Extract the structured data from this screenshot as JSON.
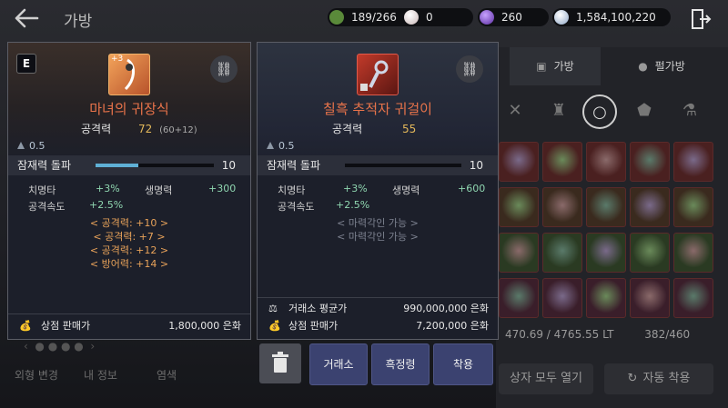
{
  "header": {
    "title": "가방",
    "currencies": [
      {
        "icon": "green-gem-icon",
        "value": "189/266"
      },
      {
        "icon": "pearl-icon",
        "value": "0"
      },
      {
        "icon": "purple-crystal-icon",
        "value": "260"
      },
      {
        "icon": "silver-coin-icon",
        "value": "1,584,100,220"
      }
    ]
  },
  "right_panel": {
    "tabs": [
      "가방",
      "펄가방"
    ],
    "weight": "470.69 / 4765.55 LT",
    "slots": "382/460",
    "buttons": {
      "open_all": "상자 모두 열기",
      "auto_equip": "자동 착용"
    }
  },
  "left_bottom": {
    "tabs": [
      "외형 변경",
      "내 정보",
      "염색"
    ]
  },
  "card_equipped": {
    "badge": "E",
    "name": "마녀의 귀장식",
    "enhance": "+3",
    "stat_label": "공격력",
    "stat_value": "72",
    "stat_extra": "(60+12)",
    "weight": "0.5",
    "potential_label": "잠재력 돌파",
    "potential_value": "10",
    "potential_fill": 0.36,
    "stats": [
      {
        "label": "치명타",
        "value": "+3%",
        "label2": "생명력",
        "value2": "+300"
      },
      {
        "label": "공격속도",
        "value": "+2.5%"
      }
    ],
    "engraves": [
      "< 공격력: +10 >",
      "< 공격력: +7 >",
      "< 공격력: +12 >",
      "< 방어력: +14 >"
    ],
    "shop_price_label": "상점 판매가",
    "shop_price": "1,800,000 은화"
  },
  "card_compare": {
    "name": "칠흑 추적자 귀걸이",
    "stat_label": "공격력",
    "stat_value": "55",
    "weight": "0.5",
    "potential_label": "잠재력 돌파",
    "potential_value": "10",
    "potential_fill": 0.0,
    "stats": [
      {
        "label": "치명타",
        "value": "+3%",
        "label2": "생명력",
        "value2": "+600"
      },
      {
        "label": "공격속도",
        "value": "+2.5%"
      }
    ],
    "engraves": [
      "< 마력각인 가능 >",
      "< 마력각인 가능 >"
    ],
    "market_price_label": "거래소 평균가",
    "market_price": "990,000,000 은화",
    "shop_price_label": "상점 판매가",
    "shop_price": "7,200,000 은화",
    "buttons": {
      "trade": "거래소",
      "refine": "흑정령",
      "equip": "착용"
    }
  },
  "colors": {
    "accent_orange": "#e8734a",
    "stat_gold": "#e3b85a",
    "stat_green": "#8fd6b0",
    "engrave_orange": "#e9a35a",
    "disabled_grey": "#7d8290"
  }
}
